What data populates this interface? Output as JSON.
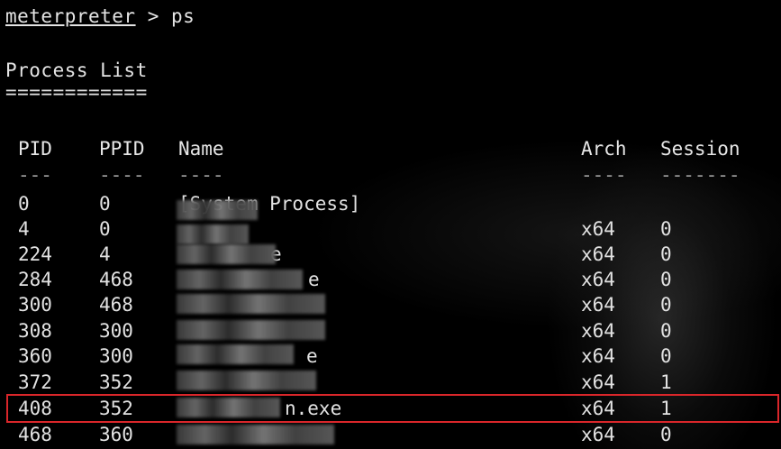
{
  "prompt": {
    "label": "meterpreter",
    "command": " > ps"
  },
  "section": {
    "title": "Process List",
    "underline": "============"
  },
  "columns": {
    "pid": "PID",
    "ppid": "PPID",
    "name": "Name",
    "arch": "Arch",
    "session": "Session"
  },
  "dashes": {
    "pid": "---",
    "ppid": "----",
    "name": "----",
    "arch": "----",
    "session": "-------"
  },
  "rows": [
    {
      "pid": "0",
      "ppid": "0",
      "name": "[System Process]",
      "arch": "",
      "session": ""
    },
    {
      "pid": "4",
      "ppid": "0",
      "name": "",
      "arch": "x64",
      "session": "0"
    },
    {
      "pid": "224",
      "ppid": "4",
      "name": "e",
      "arch": "x64",
      "session": "0"
    },
    {
      "pid": "284",
      "ppid": "468",
      "name": "e",
      "arch": "x64",
      "session": "0"
    },
    {
      "pid": "300",
      "ppid": "468",
      "name": "",
      "arch": "x64",
      "session": "0"
    },
    {
      "pid": "308",
      "ppid": "300",
      "name": "",
      "arch": "x64",
      "session": "0"
    },
    {
      "pid": "360",
      "ppid": "300",
      "name": "e",
      "arch": "x64",
      "session": "0"
    },
    {
      "pid": "372",
      "ppid": "352",
      "name": "",
      "arch": "x64",
      "session": "1"
    },
    {
      "pid": "408",
      "ppid": "352",
      "name": "n.exe",
      "arch": "x64",
      "session": "1"
    },
    {
      "pid": "468",
      "ppid": "360",
      "name": "",
      "arch": "x64",
      "session": "0"
    }
  ],
  "highlight_color": "#d9262a",
  "background_color": "#000000"
}
